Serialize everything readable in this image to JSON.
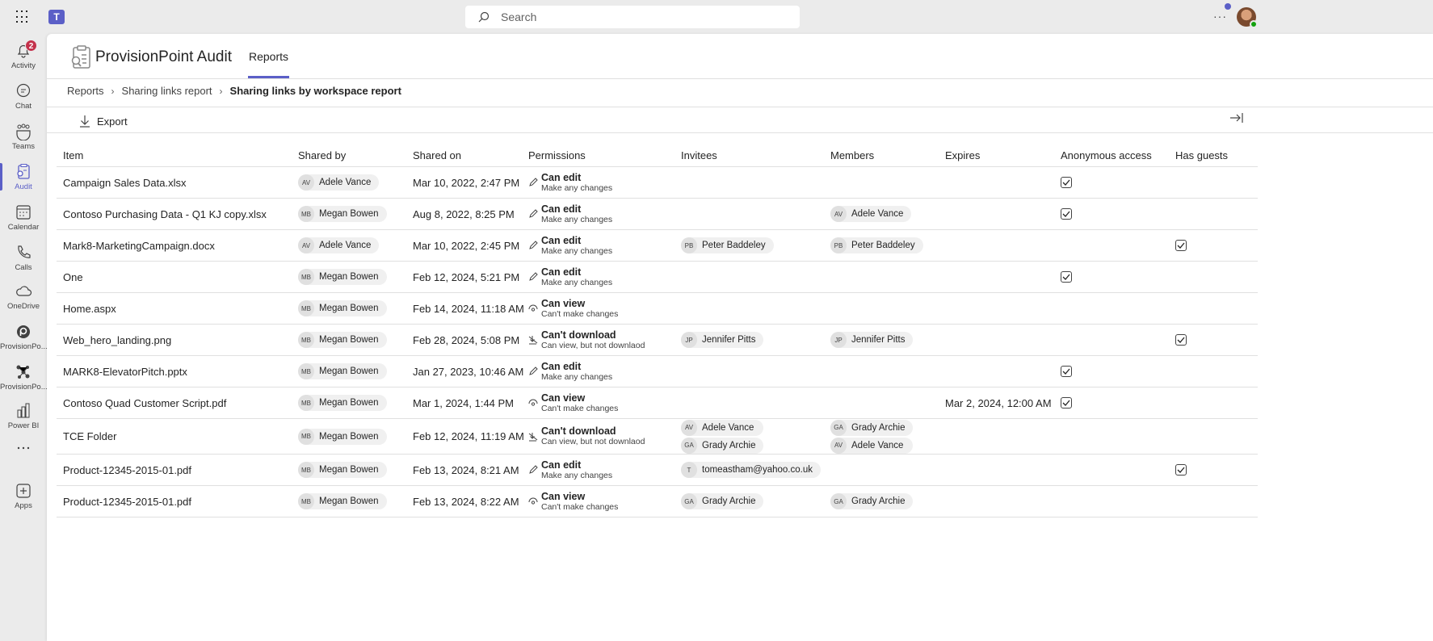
{
  "topbar": {
    "search_placeholder": "Search",
    "more": "···"
  },
  "sidebar": {
    "items": [
      {
        "label": "Activity",
        "icon": "bell-icon",
        "badge": "2"
      },
      {
        "label": "Chat",
        "icon": "chat-icon"
      },
      {
        "label": "Teams",
        "icon": "teams-icon"
      },
      {
        "label": "Audit",
        "icon": "audit-icon",
        "active": true
      },
      {
        "label": "Calendar",
        "icon": "calendar-icon"
      },
      {
        "label": "Calls",
        "icon": "phone-icon"
      },
      {
        "label": "OneDrive",
        "icon": "cloud-icon"
      },
      {
        "label": "ProvisionPo...",
        "icon": "provisionpoint-icon"
      },
      {
        "label": "ProvisionPo...",
        "icon": "network-icon"
      },
      {
        "label": "Power BI",
        "icon": "powerbi-icon"
      },
      {
        "label": "",
        "icon": "more-icon"
      },
      {
        "label": "Apps",
        "icon": "apps-icon"
      }
    ]
  },
  "app": {
    "title": "ProvisionPoint Audit",
    "tab": "Reports",
    "accent": "#5b5fc7"
  },
  "breadcrumb": [
    "Reports",
    "Sharing links report",
    "Sharing links by workspace report"
  ],
  "toolbar": {
    "export": "Export"
  },
  "table": {
    "headers": [
      "Item",
      "Shared by",
      "Shared on",
      "Permissions",
      "Invitees",
      "Members",
      "Expires",
      "Anonymous access",
      "Has guests"
    ],
    "rows": [
      {
        "item": "Campaign Sales Data.xlsx",
        "by": {
          "ini": "AV",
          "name": "Adele Vance"
        },
        "on": "Mar 10, 2022, 2:47 PM",
        "perm": {
          "type": "edit",
          "title": "Can edit",
          "sub": "Make any changes"
        },
        "invitees": [],
        "members": [],
        "expires": "",
        "anon": true,
        "guests": false
      },
      {
        "item": "Contoso Purchasing Data - Q1 KJ copy.xlsx",
        "by": {
          "ini": "MB",
          "name": "Megan Bowen"
        },
        "on": "Aug 8, 2022, 8:25 PM",
        "perm": {
          "type": "edit",
          "title": "Can edit",
          "sub": "Make any changes"
        },
        "invitees": [],
        "members": [
          {
            "ini": "AV",
            "name": "Adele Vance"
          }
        ],
        "expires": "",
        "anon": true,
        "guests": false
      },
      {
        "item": "Mark8-MarketingCampaign.docx",
        "by": {
          "ini": "AV",
          "name": "Adele Vance"
        },
        "on": "Mar 10, 2022, 2:45 PM",
        "perm": {
          "type": "edit",
          "title": "Can edit",
          "sub": "Make any changes"
        },
        "invitees": [
          {
            "ini": "PB",
            "name": "Peter Baddeley"
          }
        ],
        "members": [
          {
            "ini": "PB",
            "name": "Peter Baddeley"
          }
        ],
        "expires": "",
        "anon": false,
        "guests": true
      },
      {
        "item": "One",
        "by": {
          "ini": "MB",
          "name": "Megan Bowen"
        },
        "on": "Feb 12, 2024, 5:21 PM",
        "perm": {
          "type": "edit",
          "title": "Can edit",
          "sub": "Make any changes"
        },
        "invitees": [],
        "members": [],
        "expires": "",
        "anon": true,
        "guests": false
      },
      {
        "item": "Home.aspx",
        "by": {
          "ini": "MB",
          "name": "Megan Bowen"
        },
        "on": "Feb 14, 2024, 11:18 AM",
        "perm": {
          "type": "view",
          "title": "Can view",
          "sub": "Can't make changes"
        },
        "invitees": [],
        "members": [],
        "expires": "",
        "anon": false,
        "guests": false
      },
      {
        "item": "Web_hero_landing.png",
        "by": {
          "ini": "MB",
          "name": "Megan Bowen"
        },
        "on": "Feb 28, 2024, 5:08 PM",
        "perm": {
          "type": "nodownload",
          "title": "Can't download",
          "sub": "Can view, but not downlaod"
        },
        "invitees": [
          {
            "ini": "JP",
            "name": "Jennifer Pitts"
          }
        ],
        "members": [
          {
            "ini": "JP",
            "name": "Jennifer Pitts"
          }
        ],
        "expires": "",
        "anon": false,
        "guests": true
      },
      {
        "item": "MARK8-ElevatorPitch.pptx",
        "by": {
          "ini": "MB",
          "name": "Megan Bowen"
        },
        "on": "Jan 27, 2023, 10:46 AM",
        "perm": {
          "type": "edit",
          "title": "Can edit",
          "sub": "Make any changes"
        },
        "invitees": [],
        "members": [],
        "expires": "",
        "anon": true,
        "guests": false
      },
      {
        "item": "Contoso Quad Customer Script.pdf",
        "by": {
          "ini": "MB",
          "name": "Megan Bowen"
        },
        "on": "Mar 1, 2024, 1:44 PM",
        "perm": {
          "type": "view",
          "title": "Can view",
          "sub": "Can't make changes"
        },
        "invitees": [],
        "members": [],
        "expires": "Mar 2, 2024, 12:00 AM",
        "anon": true,
        "guests": false
      },
      {
        "item": "TCE Folder",
        "by": {
          "ini": "MB",
          "name": "Megan Bowen"
        },
        "on": "Feb 12, 2024, 11:19 AM",
        "perm": {
          "type": "nodownload",
          "title": "Can't download",
          "sub": "Can view, but not downlaod"
        },
        "invitees": [
          {
            "ini": "AV",
            "name": "Adele Vance"
          },
          {
            "ini": "GA",
            "name": "Grady Archie"
          }
        ],
        "members": [
          {
            "ini": "GA",
            "name": "Grady Archie"
          },
          {
            "ini": "AV",
            "name": "Adele Vance"
          }
        ],
        "expires": "",
        "anon": false,
        "guests": false
      },
      {
        "item": "Product-12345-2015-01.pdf",
        "by": {
          "ini": "MB",
          "name": "Megan Bowen"
        },
        "on": "Feb 13, 2024, 8:21 AM",
        "perm": {
          "type": "edit",
          "title": "Can edit",
          "sub": "Make any changes"
        },
        "invitees": [
          {
            "ini": "T",
            "name": "tomeastham@yahoo.co.uk"
          }
        ],
        "members": [],
        "expires": "",
        "anon": false,
        "guests": true
      },
      {
        "item": "Product-12345-2015-01.pdf",
        "by": {
          "ini": "MB",
          "name": "Megan Bowen"
        },
        "on": "Feb 13, 2024, 8:22 AM",
        "perm": {
          "type": "view",
          "title": "Can view",
          "sub": "Can't make changes"
        },
        "invitees": [
          {
            "ini": "GA",
            "name": "Grady Archie"
          }
        ],
        "members": [
          {
            "ini": "GA",
            "name": "Grady Archie"
          }
        ],
        "expires": "",
        "anon": false,
        "guests": false
      }
    ]
  }
}
